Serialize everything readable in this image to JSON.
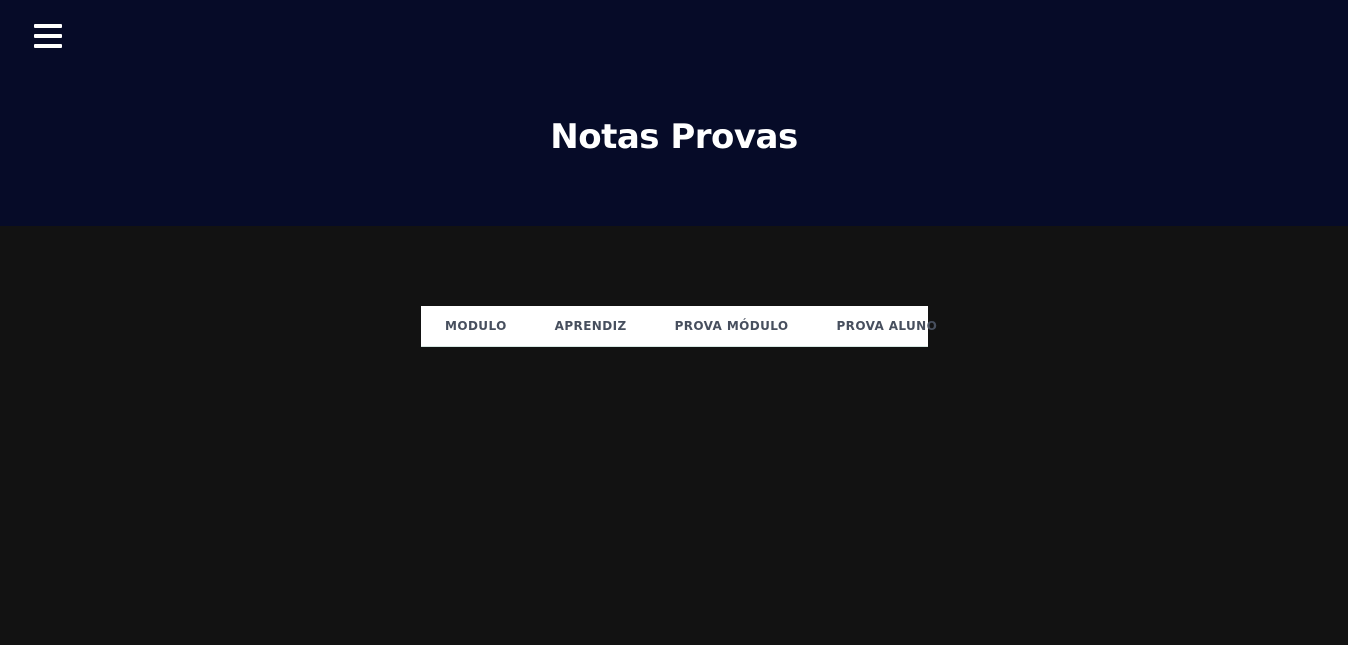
{
  "header": {
    "menu_icon": "hamburger-menu-icon",
    "title": "Notas Provas",
    "background_color": "#060b28"
  },
  "main": {
    "background_color": "#121212",
    "tabs": [
      {
        "label": "MODULO"
      },
      {
        "label": "APRENDIZ"
      },
      {
        "label": "PROVA MÓDULO"
      },
      {
        "label": "PROVA ALUNO"
      }
    ]
  }
}
